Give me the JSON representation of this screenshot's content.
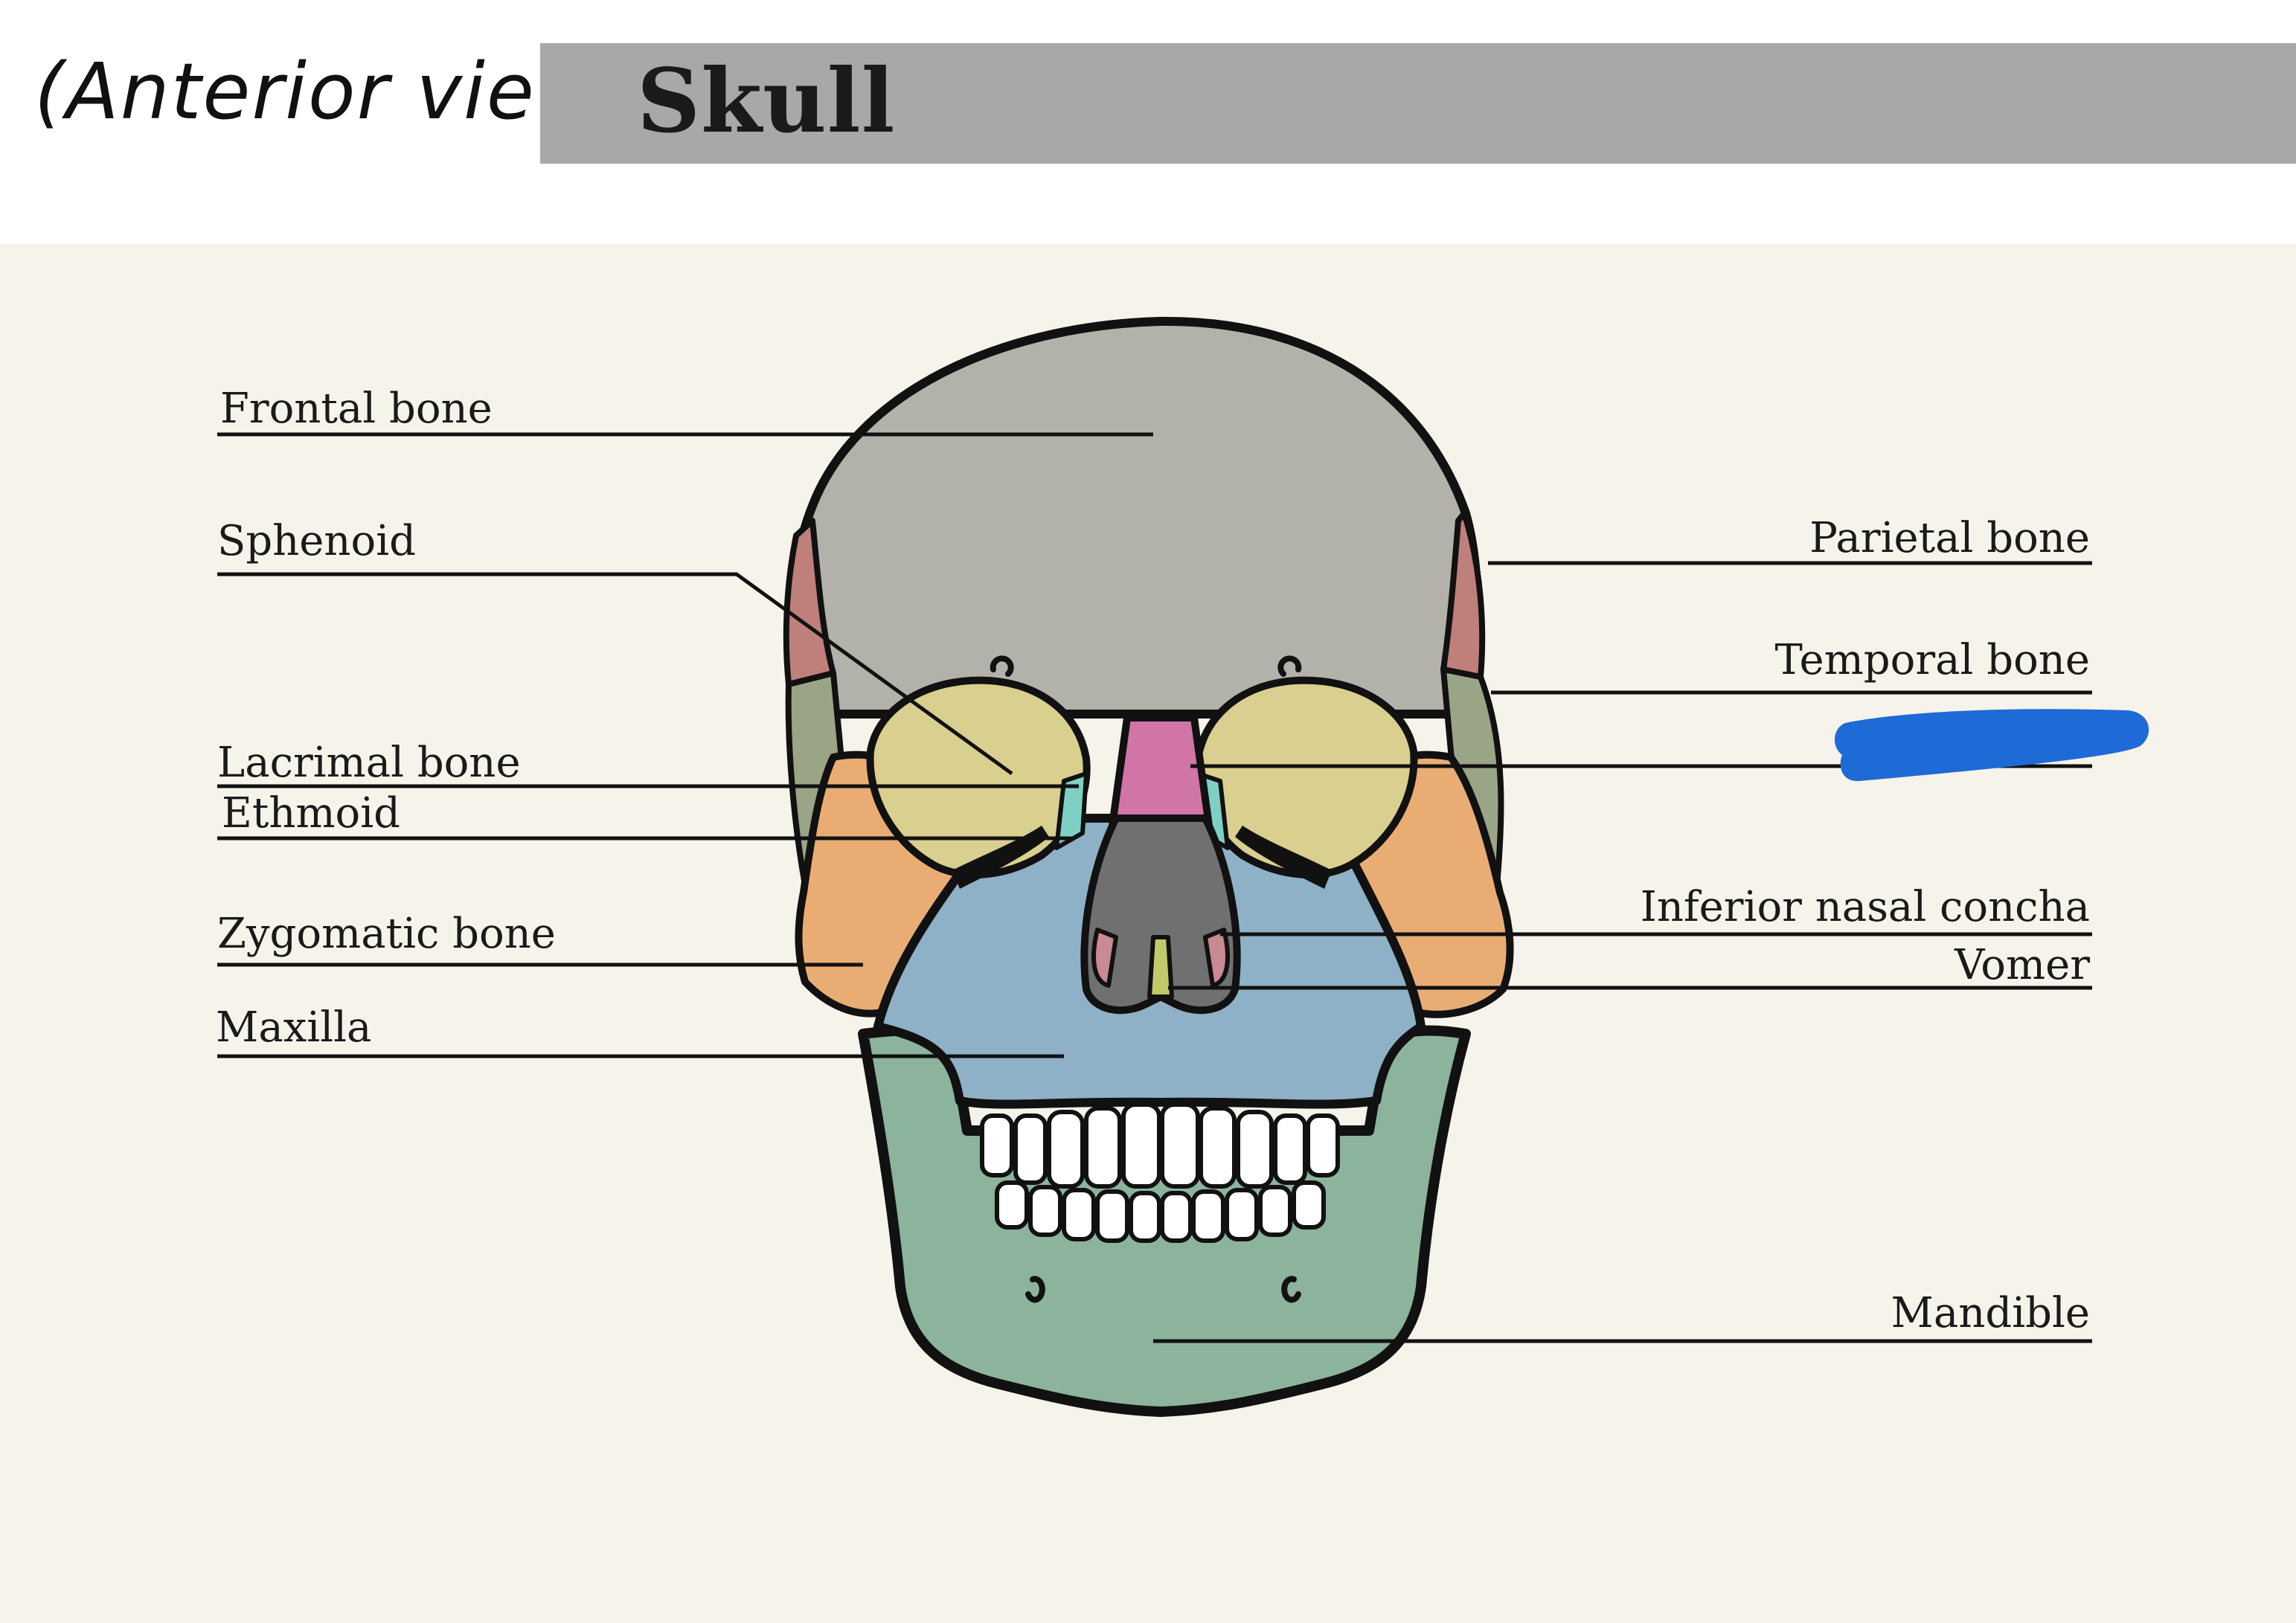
{
  "header": {
    "handwritten_note": "(Anterior view)",
    "title": "Skull"
  },
  "labels": {
    "left": [
      "Frontal bone",
      "Sphenoid",
      "Lacrimal bone",
      "Ethmoid",
      "Zygomatic bone",
      "Maxilla"
    ],
    "right": [
      "Parietal bone",
      "Temporal bone",
      "Inferior nasal concha",
      "Vomer",
      "Mandible"
    ]
  },
  "colors": {
    "page_background": "#f6f4ea",
    "title_bar": "#a8a8a8",
    "frontal": "#b3b2aa",
    "parietal": "#bf7f7b",
    "temporal": "#9aa486",
    "sphenoid": "#d9cf8e",
    "zygomatic": "#e9ad74",
    "maxilla": "#8fb1c7",
    "mandible": "#8cb39c",
    "nasal": "#d174a6",
    "ethmoid": "#7fd0c4",
    "vomer": "#707070",
    "redaction_mark": "#1e6ad6"
  }
}
